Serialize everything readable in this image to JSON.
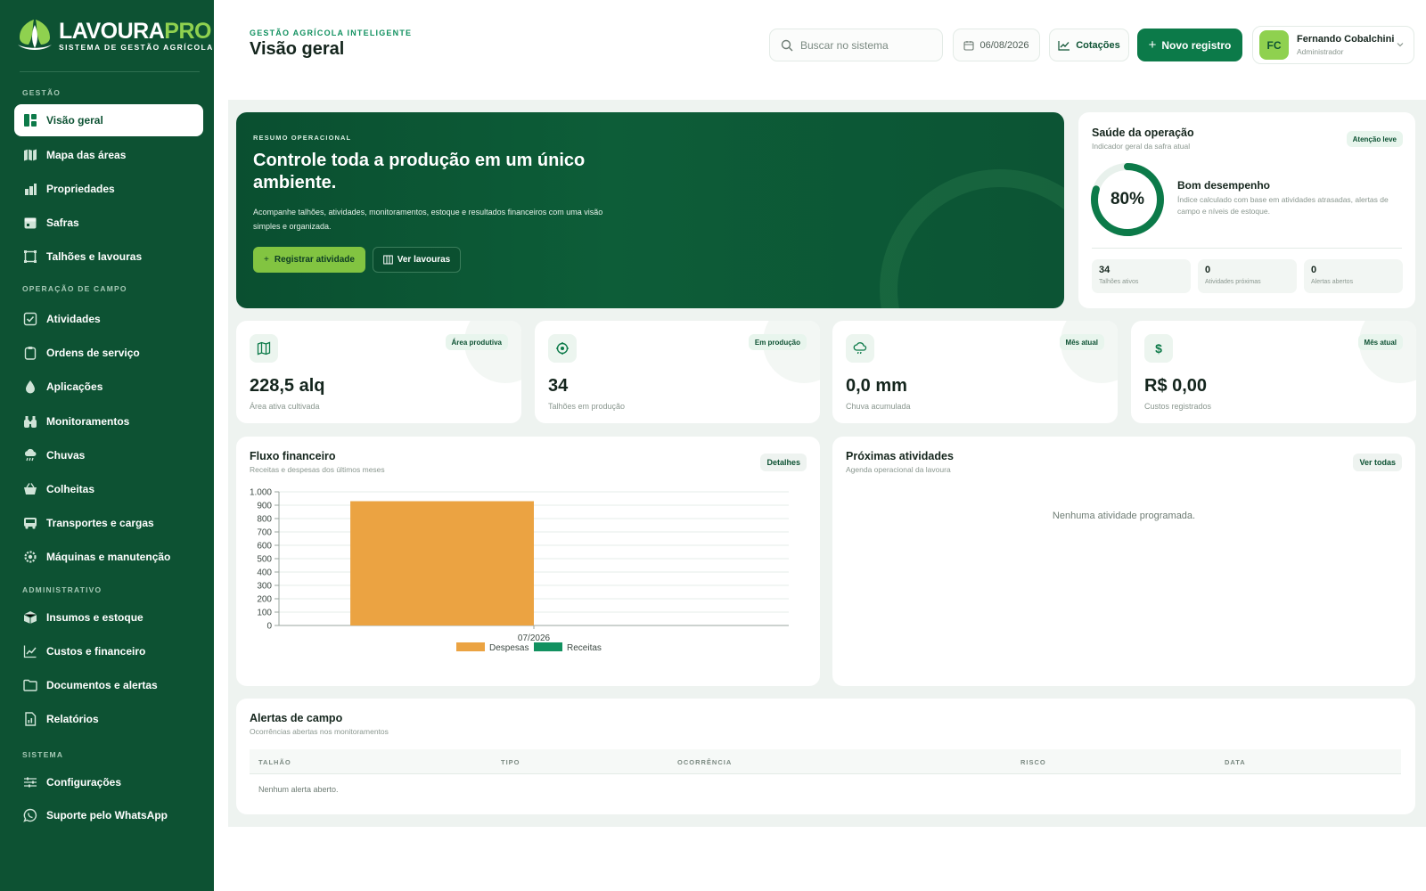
{
  "brand": {
    "name_main": "LAVOURA",
    "name_accent": "PRO",
    "tagline": "SISTEMA DE GESTÃO AGRÍCOLA"
  },
  "sidebar": {
    "sections": [
      {
        "title": "GESTÃO",
        "items": [
          {
            "label": "Visão geral",
            "icon": "dashboard-icon",
            "active": true
          },
          {
            "label": "Mapa das áreas",
            "icon": "map-icon"
          },
          {
            "label": "Propriedades",
            "icon": "property-icon"
          },
          {
            "label": "Safras",
            "icon": "harvest-calendar-icon"
          },
          {
            "label": "Talhões e lavouras",
            "icon": "field-plot-icon"
          }
        ]
      },
      {
        "title": "OPERAÇÃO DE CAMPO",
        "items": [
          {
            "label": "Atividades",
            "icon": "checklist-icon"
          },
          {
            "label": "Ordens de serviço",
            "icon": "clipboard-icon"
          },
          {
            "label": "Aplicações",
            "icon": "droplet-icon"
          },
          {
            "label": "Monitoramentos",
            "icon": "binoculars-icon"
          },
          {
            "label": "Chuvas",
            "icon": "rain-icon"
          },
          {
            "label": "Colheitas",
            "icon": "basket-icon"
          },
          {
            "label": "Transportes e cargas",
            "icon": "truck-icon"
          },
          {
            "label": "Máquinas e manutenção",
            "icon": "gear-icon"
          }
        ]
      },
      {
        "title": "ADMINISTRATIVO",
        "items": [
          {
            "label": "Insumos e estoque",
            "icon": "box-icon"
          },
          {
            "label": "Custos e financeiro",
            "icon": "trend-icon"
          },
          {
            "label": "Documentos e alertas",
            "icon": "folder-icon"
          },
          {
            "label": "Relatórios",
            "icon": "report-icon"
          }
        ]
      },
      {
        "title": "SISTEMA",
        "items": [
          {
            "label": "Configurações",
            "icon": "sliders-icon"
          },
          {
            "label": "Suporte pelo WhatsApp",
            "icon": "whatsapp-icon"
          }
        ]
      }
    ]
  },
  "header": {
    "eyebrow": "GESTÃO AGRÍCOLA INTELIGENTE",
    "title": "Visão geral",
    "search_placeholder": "Buscar no sistema",
    "date": "06/08/2026",
    "quotes_label": "Cotações",
    "new_label": "Novo registro",
    "user": {
      "initials": "FC",
      "name": "Fernando Cobalchini",
      "role": "Administrador"
    }
  },
  "hero": {
    "eyebrow": "RESUMO OPERACIONAL",
    "title": "Controle toda a produção em um único ambiente.",
    "description": "Acompanhe talhões, atividades, monitoramentos, estoque e resultados financeiros com uma visão simples e organizada.",
    "primary_label": "Registrar atividade",
    "secondary_label": "Ver lavouras"
  },
  "health": {
    "title": "Saúde da operação",
    "subtitle": "Indicador geral da safra atual",
    "badge": "Atenção leve",
    "score": 0.8,
    "score_label": "80%",
    "status": "Bom desempenho",
    "description": "Índice calculado com base em atividades atrasadas, alertas de campo e níveis de estoque.",
    "metrics": [
      {
        "value": "34",
        "label": "Talhões ativos"
      },
      {
        "value": "0",
        "label": "Atividades próximas"
      },
      {
        "value": "0",
        "label": "Alertas abertos"
      }
    ]
  },
  "stats": [
    {
      "icon": "map-icon",
      "badge": "Área produtiva",
      "value": "228,5 alq",
      "label": "Área ativa cultivada"
    },
    {
      "icon": "sprout-icon",
      "badge": "Em produção",
      "value": "34",
      "label": "Talhões em produção"
    },
    {
      "icon": "rain-cloud-icon",
      "badge": "Mês atual",
      "value": "0,0 mm",
      "label": "Chuva acumulada"
    },
    {
      "icon": "dollar-icon",
      "badge": "Mês atual",
      "value": "R$ 0,00",
      "label": "Custos registrados"
    }
  ],
  "finance": {
    "title": "Fluxo financeiro",
    "subtitle": "Receitas e despesas dos últimos meses",
    "details_label": "Detalhes"
  },
  "chart_data": {
    "type": "bar",
    "categories": [
      "07/2026"
    ],
    "series": [
      {
        "name": "Despesas",
        "values": [
          930
        ],
        "color": "#eba342"
      },
      {
        "name": "Receitas",
        "values": [
          0
        ],
        "color": "#129160"
      }
    ],
    "ylim": [
      0,
      1000
    ],
    "yticks": [
      "0",
      "100",
      "200",
      "300",
      "400",
      "500",
      "600",
      "700",
      "800",
      "900",
      "1.000"
    ],
    "grid": true,
    "legend": "bottom"
  },
  "activities": {
    "title": "Próximas atividades",
    "subtitle": "Agenda operacional da lavoura",
    "view_all_label": "Ver todas",
    "empty": "Nenhuma atividade programada."
  },
  "alerts": {
    "title": "Alertas de campo",
    "subtitle": "Ocorrências abertas nos monitoramentos",
    "columns": [
      "TALHÃO",
      "TIPO",
      "OCORRÊNCIA",
      "RISCO",
      "DATA"
    ],
    "empty": "Nenhum alerta aberto."
  }
}
